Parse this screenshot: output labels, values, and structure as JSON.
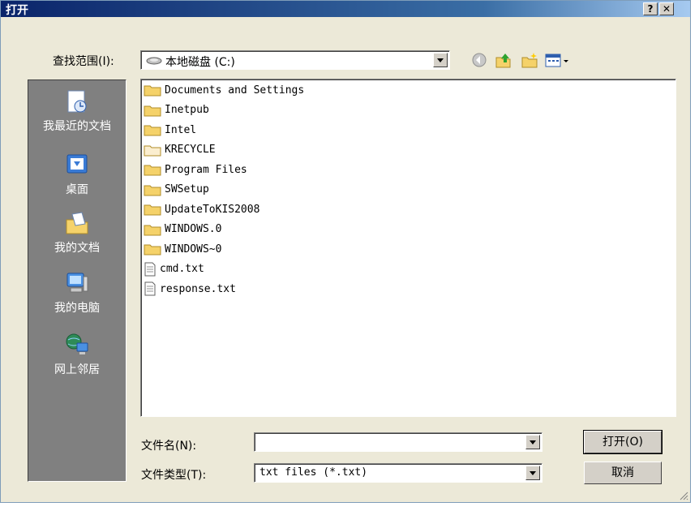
{
  "window": {
    "title": "打开",
    "help_label": "?",
    "close_label": "✕"
  },
  "lookin": {
    "label": "查找范围(I):",
    "value": "本地磁盘 (C:)",
    "icon": "drive-icon"
  },
  "toolbar": {
    "icons": [
      "back-icon",
      "up-folder-icon",
      "new-folder-icon",
      "view-menu-icon"
    ]
  },
  "places": [
    {
      "label": "我最近的文档",
      "icon": "recent-docs-icon"
    },
    {
      "label": "桌面",
      "icon": "desktop-icon"
    },
    {
      "label": "我的文档",
      "icon": "my-documents-icon"
    },
    {
      "label": "我的电脑",
      "icon": "my-computer-icon"
    },
    {
      "label": "网上邻居",
      "icon": "network-places-icon"
    }
  ],
  "files": [
    {
      "name": "Documents and Settings",
      "type": "folder"
    },
    {
      "name": "Inetpub",
      "type": "folder"
    },
    {
      "name": "Intel",
      "type": "folder"
    },
    {
      "name": "KRECYCLE",
      "type": "folder-hidden"
    },
    {
      "name": "Program Files",
      "type": "folder"
    },
    {
      "name": "SWSetup",
      "type": "folder"
    },
    {
      "name": "UpdateToKIS2008",
      "type": "folder"
    },
    {
      "name": "WINDOWS.0",
      "type": "folder"
    },
    {
      "name": "WINDOWS~0",
      "type": "folder"
    },
    {
      "name": "cmd.txt",
      "type": "text"
    },
    {
      "name": "response.txt",
      "type": "text"
    }
  ],
  "filename": {
    "label": "文件名(N):",
    "value": ""
  },
  "filetype": {
    "label": "文件类型(T):",
    "value": "txt files (*.txt)"
  },
  "buttons": {
    "open": "打开(O)",
    "cancel": "取消"
  },
  "colors": {
    "title_start": "#0a246a",
    "title_end": "#a6caf0",
    "dialog_bg": "#ece9d8",
    "places_bg": "#808080",
    "folder": "#f5d26a"
  }
}
